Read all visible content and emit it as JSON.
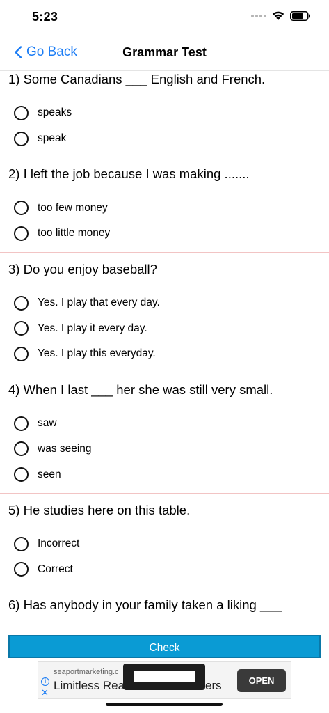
{
  "status_bar": {
    "time": "5:23"
  },
  "nav": {
    "back_label": "Go Back",
    "title": "Grammar Test"
  },
  "questions": [
    {
      "text": "1) Some Canadians ___ English and French.",
      "options": [
        "speaks",
        "speak"
      ]
    },
    {
      "text": "2) I left the job because I was making .......",
      "options": [
        "too few money",
        "too little money"
      ]
    },
    {
      "text": "3) Do you enjoy baseball?",
      "options": [
        "Yes. I play that every day.",
        "Yes. I play it every day.",
        "Yes. I play this everyday."
      ]
    },
    {
      "text": "4) When I last ___ her she was still very small.",
      "options": [
        "saw",
        "was seeing",
        "seen"
      ]
    },
    {
      "text": "5) He studies here on this table.",
      "options": [
        "Incorrect",
        "Correct"
      ]
    },
    {
      "text": "6) Has anybody in your family taken a liking ___",
      "options": []
    }
  ],
  "check_button": {
    "label": "Check"
  },
  "ad": {
    "domain": "seaportmarketing.c",
    "headline_left": "Limitless Rea",
    "headline_right": "ers",
    "open_label": "OPEN"
  },
  "icons": {
    "back": "chevron-left-icon",
    "wifi": "wifi-icon",
    "battery": "battery-icon",
    "signal": "signal-dots-icon",
    "ad_info": "info-icon",
    "ad_close": "close-icon"
  },
  "colors": {
    "accent": "#1a7cf5",
    "check_button": "#0a9bd4",
    "divider": "#f2c4c4"
  }
}
